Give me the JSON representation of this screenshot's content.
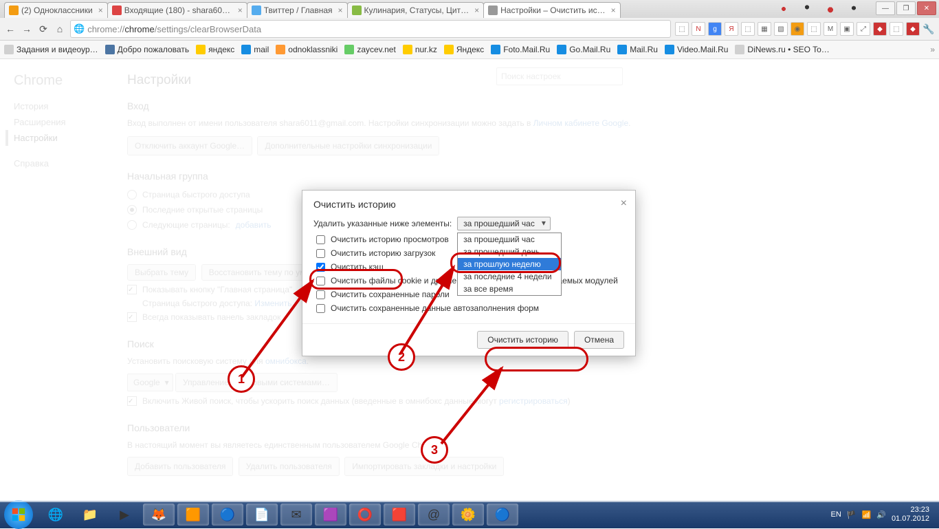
{
  "tabs": [
    {
      "label": "(2) Одноклассники"
    },
    {
      "label": "Входящие (180) - shara601…"
    },
    {
      "label": "Твиттер / Главная"
    },
    {
      "label": "Кулинария, Статусы, Цит…"
    },
    {
      "label": "Настройки – Очистить ис…"
    }
  ],
  "omnibox": {
    "prefix": "chrome://",
    "mid": "chrome",
    "suffix": "/settings/clearBrowserData"
  },
  "bookmarks": [
    "Задания и видеоур…",
    "Добро пожаловать",
    "яндекс",
    "mail",
    "odnoklassniki",
    "zaycev.net",
    "nur.kz",
    "Яндекс",
    "Foto.Mail.Ru",
    "Go.Mail.Ru",
    "Mail.Ru",
    "Video.Mail.Ru",
    "DiNews.ru • SEO To…"
  ],
  "side": {
    "brand": "Chrome",
    "items": [
      "История",
      "Расширения",
      "Настройки",
      "Справка"
    ],
    "active": 2
  },
  "settings": {
    "title": "Настройки",
    "search_placeholder": "Поиск настроек",
    "login": {
      "h": "Вход",
      "text": "Вход выполнен от имени пользователя shara6011@gmail.com. Настройки синхронизации можно задать в ",
      "link": "Личном кабинете Google",
      "btn1": "Отключить аккаунт Google…",
      "btn2": "Дополнительные настройки синхронизации"
    },
    "startup": {
      "h": "Начальная группа",
      "r1": "Страница быстрого доступа",
      "r2": "Последние открытые страницы",
      "r3": "Следующие страницы:",
      "add": "добавить"
    },
    "look": {
      "h": "Внешний вид",
      "btn1": "Выбрать тему",
      "btn2": "Восстановить тему по умолчанию",
      "c1": "Показывать кнопку \"Главная страница\"",
      "quick": "Страница быстрого доступа:",
      "change": "Изменить",
      "c2": "Всегда показывать панель закладок"
    },
    "search": {
      "h": "Поиск",
      "text": "Установить поисковую систему для ",
      "omni": "омнибокса",
      "engine": "Google",
      "btn": "Управление поисковыми системами…",
      "c": "Включить Живой поиск, чтобы ускорить поиск данных (введенные в омнибокс данные могут ",
      "reg": "регистрироваться",
      ")": ")"
    },
    "users": {
      "h": "Пользователи",
      "text": "В настоящий момент вы являетесь единственным пользователем Google Chrome.",
      "b1": "Добавить пользователя",
      "b2": "Удалить пользователя",
      "b3": "Импортировать закладки и настройки"
    }
  },
  "dialog": {
    "title": "Очистить историю",
    "label": "Удалить указанные ниже элементы:",
    "selected": "за прошедший час",
    "options": [
      "за прошедший час",
      "за прошедший день",
      "за прошлую неделю",
      "за последние 4 недели",
      "за все время"
    ],
    "highlight_index": 2,
    "checks": [
      {
        "label": "Очистить историю просмотров",
        "on": false
      },
      {
        "label": "Очистить историю загрузок",
        "on": false
      },
      {
        "label": "Очистить кэш",
        "on": true
      },
      {
        "label": "Очистить файлы cookie и другие данные сайтов и подключаемых модулей",
        "on": false
      },
      {
        "label": "Очистить сохраненные пароли",
        "on": false
      },
      {
        "label": "Очистить сохраненные данные автозаполнения форм",
        "on": false
      }
    ],
    "btn_clear": "Очистить историю",
    "btn_cancel": "Отмена"
  },
  "annotations": {
    "n1": "1",
    "n2": "2",
    "n3": "3"
  },
  "taskbar": {
    "lang": "EN",
    "time": "23:23",
    "date": "01.07.2012"
  }
}
